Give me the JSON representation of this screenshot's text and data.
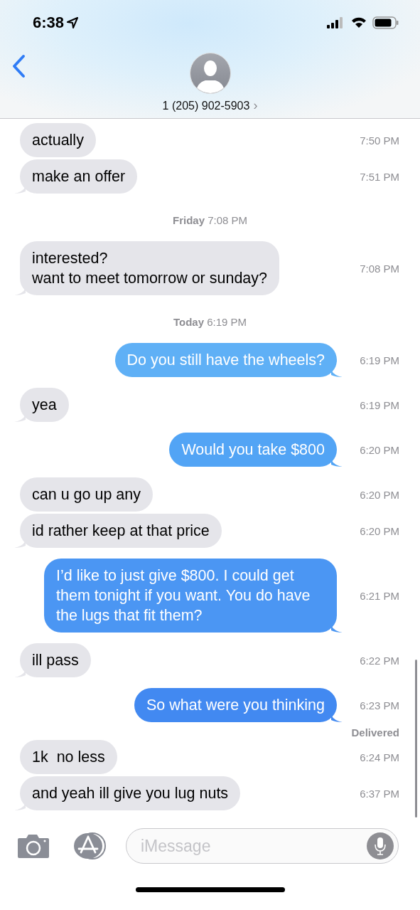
{
  "status_bar": {
    "time": "6:38"
  },
  "contact": {
    "phone": "1 (205) 902-5903",
    "chevron": "›"
  },
  "messages": [
    {
      "kind": "message",
      "outgoing": false,
      "text": "actually",
      "time": "7:50 PM"
    },
    {
      "kind": "message",
      "outgoing": false,
      "text": "make an offer",
      "time": "7:51 PM"
    },
    {
      "kind": "separator",
      "day": "Friday",
      "time": "7:08 PM"
    },
    {
      "kind": "message",
      "outgoing": false,
      "text": "interested?\nwant to meet tomorrow or sunday?",
      "time": "7:08 PM"
    },
    {
      "kind": "separator",
      "day": "Today",
      "time": "6:19 PM"
    },
    {
      "kind": "message",
      "outgoing": true,
      "text": "Do you still have the wheels?",
      "time": "6:19 PM"
    },
    {
      "kind": "message",
      "outgoing": false,
      "text": "yea",
      "time": "6:19 PM"
    },
    {
      "kind": "message",
      "outgoing": true,
      "text": "Would you take $800",
      "time": "6:20 PM"
    },
    {
      "kind": "message",
      "outgoing": false,
      "text": "can u go up any",
      "time": "6:20 PM"
    },
    {
      "kind": "message",
      "outgoing": false,
      "text": "id rather keep at that price",
      "time": "6:20 PM"
    },
    {
      "kind": "message",
      "outgoing": true,
      "text": "I’d like to just give $800. I could get them tonight if you want. You do have the lugs that fit them?",
      "time": "6:21 PM"
    },
    {
      "kind": "message",
      "outgoing": false,
      "text": "ill pass",
      "time": "6:22 PM"
    },
    {
      "kind": "message",
      "outgoing": true,
      "text": "So what were you thinking",
      "time": "6:23 PM"
    },
    {
      "kind": "status",
      "text": "Delivered"
    },
    {
      "kind": "message",
      "outgoing": false,
      "text": "1k  no less",
      "time": "6:24 PM"
    },
    {
      "kind": "message",
      "outgoing": false,
      "text": "and yeah ill give you lug nuts",
      "time": "6:37 PM"
    }
  ],
  "composer": {
    "placeholder": "iMessage"
  }
}
